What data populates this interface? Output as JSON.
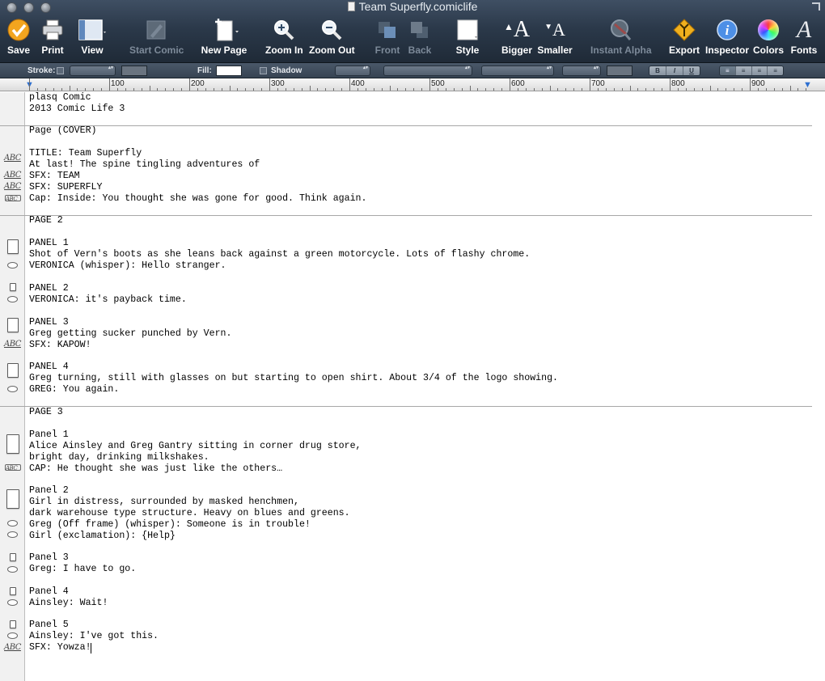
{
  "window": {
    "title": "Team Superfly.comiclife"
  },
  "toolbar": {
    "save": "Save",
    "print": "Print",
    "view": "View",
    "start_comic": "Start Comic",
    "new_page": "New Page",
    "zoom_in": "Zoom In",
    "zoom_out": "Zoom Out",
    "front": "Front",
    "back": "Back",
    "style": "Style",
    "bigger": "Bigger",
    "smaller": "Smaller",
    "instant_alpha": "Instant Alpha",
    "export": "Export",
    "inspector": "Inspector",
    "colors": "Colors",
    "fonts": "Fonts",
    "glyph_A": "A"
  },
  "format_bar": {
    "stroke_label": "Stroke:",
    "fill_label": "Fill:",
    "shadow_label": "Shadow",
    "style_buttons": [
      "B",
      "I",
      "U"
    ],
    "align_buttons": [
      "≡",
      "≡",
      "≡",
      "≡"
    ]
  },
  "ruler": {
    "numbers": [
      "100",
      "200",
      "300",
      "400",
      "500",
      "600",
      "700",
      "800",
      "900"
    ]
  },
  "script": {
    "gutter_abc": "ABC",
    "lines": [
      "plasq Comic",
      "2013 Comic Life 3",
      "Page (COVER)",
      "TITLE: Team Superfly",
      "At last! The spine tingling adventures of",
      "SFX: TEAM",
      "SFX: SUPERFLY",
      "Cap: Inside: You thought she was gone for good. Think again.",
      "PAGE 2",
      "PANEL 1",
      "Shot of Vern's boots as she leans back against a green motorcycle. Lots of flashy chrome.",
      "VERONICA (whisper): Hello stranger.",
      "PANEL 2",
      "VERONICA: it's payback time.",
      "PANEL 3",
      "Greg getting sucker punched by Vern.",
      "SFX: KAPOW!",
      "PANEL 4",
      "Greg turning, still with glasses on but starting to open shirt. About 3/4 of the logo showing.",
      "GREG: You again.",
      "PAGE 3",
      "Panel 1",
      "Alice Ainsley and Greg Gantry sitting in corner drug store,",
      "bright day, drinking milkshakes.",
      "CAP: He thought she was just like the others…",
      "Panel 2",
      "Girl in distress, surrounded by masked henchmen,",
      "dark warehouse type structure. Heavy on blues and greens.",
      "Greg (Off frame) (whisper): Someone is in trouble!",
      "Girl (exclamation): {Help}",
      "Panel 3",
      "Greg: I have to go.",
      "Panel 4",
      "Ainsley: Wait!",
      "Panel 5",
      "Ainsley: I've got this.",
      "SFX: Yowza!"
    ]
  }
}
